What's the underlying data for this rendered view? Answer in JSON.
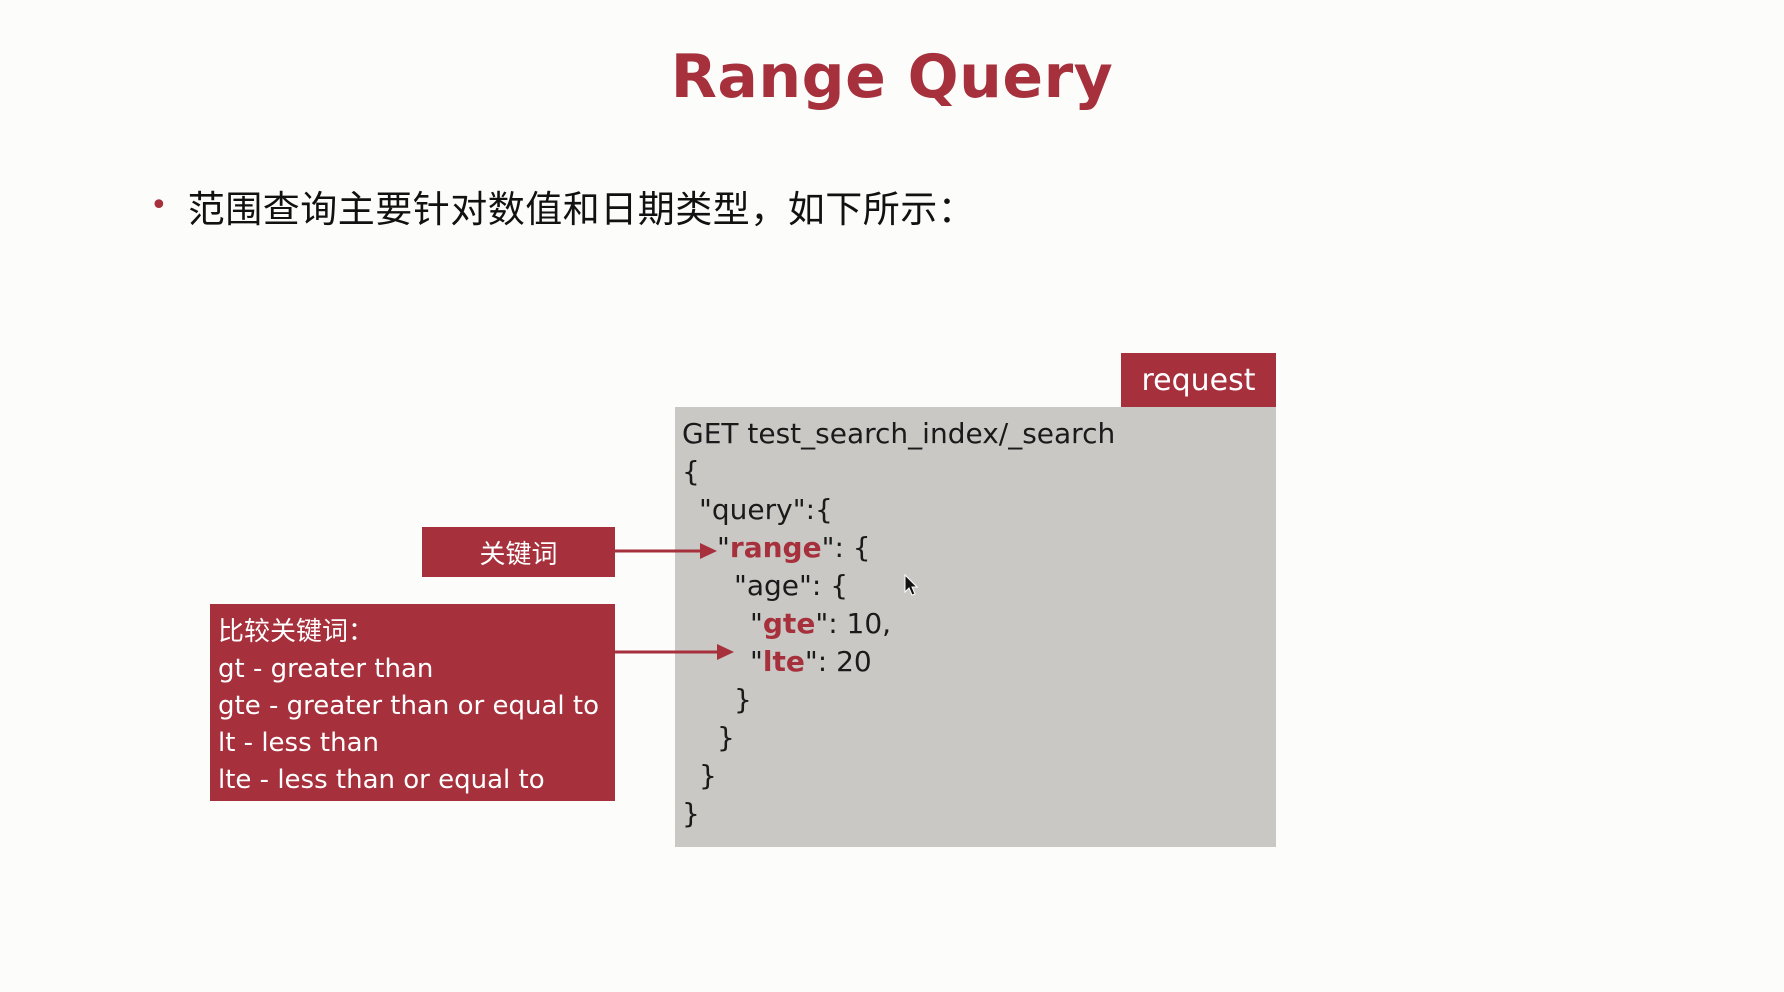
{
  "colors": {
    "accent": "#a6303b",
    "code_bg": "#cac8c4",
    "text": "#1a1a1a"
  },
  "slide": {
    "title": "Range Query",
    "bullet": "范围查询主要针对数值和日期类型，如下所示："
  },
  "request_tab": {
    "label": "request"
  },
  "code": {
    "line1": "GET test_search_index/_search",
    "line2": "{",
    "line3": "\"query\":{",
    "line4_q1": "\"",
    "line4_kw": "range",
    "line4_rest": "\": {",
    "line5": "\"age\": {",
    "line6_q1": "\"",
    "line6_kw": "gte",
    "line6_rest": "\": 10,",
    "line7_q1": "\"",
    "line7_kw": "lte",
    "line7_rest": "\": 20",
    "line8": "}",
    "line9": "}",
    "line10": "}",
    "line11": "}"
  },
  "keyword_label": "关键词",
  "compare": {
    "heading": "比较关键词：",
    "items": [
      "gt - greater than",
      "gte - greater than or equal to",
      "lt - less than",
      "lte - less than or equal to"
    ]
  },
  "icons": {
    "cursor": "mouse-pointer-icon",
    "arrow": "arrow-right-icon"
  }
}
